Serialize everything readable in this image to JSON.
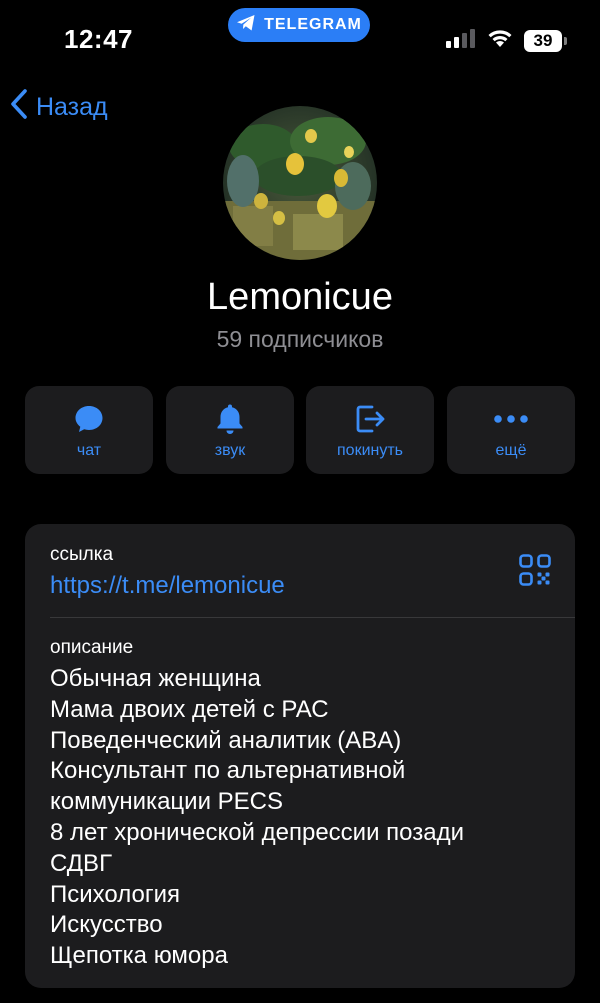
{
  "status_bar": {
    "time": "12:47",
    "app_pill": "TELEGRAM",
    "battery": "39"
  },
  "nav": {
    "back_label": "Назад"
  },
  "channel": {
    "name": "Lemonicue",
    "subscribers": "59 подписчиков"
  },
  "actions": [
    {
      "label": "чат",
      "icon": "chat-bubble-icon"
    },
    {
      "label": "звук",
      "icon": "bell-icon"
    },
    {
      "label": "покинуть",
      "icon": "leave-icon"
    },
    {
      "label": "ещё",
      "icon": "more-dots-icon"
    }
  ],
  "info": {
    "link_caption": "ссылка",
    "link": "https://t.me/lemonicue",
    "description_caption": "описание",
    "description_lines": [
      "Обычная женщина",
      "Мама двоих детей с РАС",
      "Поведенческий аналитик (ABA)",
      "Консультант по альтернативной",
      "коммуникации PECS",
      "8 лет хронической депрессии позади",
      "СДВГ",
      "Психология",
      "Искусство",
      "Щепотка юмора"
    ]
  },
  "colors": {
    "accent": "#3b8cf6",
    "background": "#000000",
    "card": "#1c1c1e",
    "secondary_text": "#8e8e93",
    "telegram_pill": "#2b7ef6"
  }
}
